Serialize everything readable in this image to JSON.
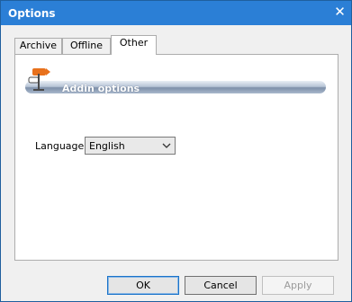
{
  "window": {
    "title": "Options"
  },
  "tabs": [
    {
      "label": "Archive"
    },
    {
      "label": "Offline"
    },
    {
      "label": "Other"
    }
  ],
  "active_tab": "Other",
  "section": {
    "label": "Addin options",
    "icon": "signpost-icon"
  },
  "language": {
    "label": "Language",
    "selected": "English"
  },
  "buttons": {
    "ok": "OK",
    "cancel": "Cancel",
    "apply": "Apply"
  },
  "colors": {
    "titlebar": "#2b7fd6",
    "icon_accent": "#e8711c"
  }
}
